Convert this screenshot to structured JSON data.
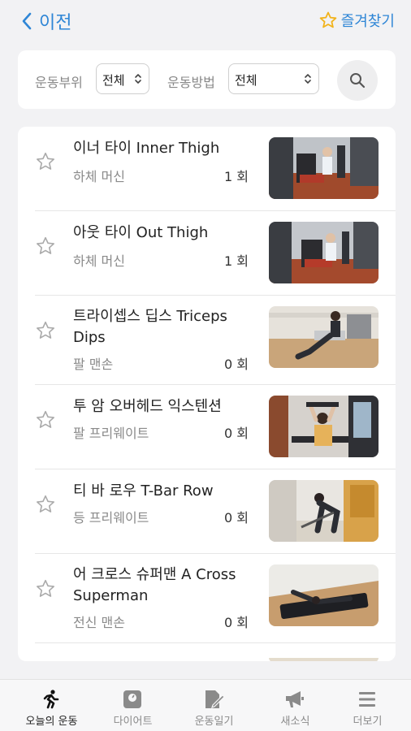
{
  "header": {
    "back_label": "이전",
    "favorites_label": "즐겨찾기",
    "accent_color": "#2f86d6",
    "favorite_star_color": "#f2b31b"
  },
  "filter": {
    "body_part_label": "운동부위",
    "body_part_value": "전체",
    "method_label": "운동방법",
    "method_value": "전체",
    "search_icon": "search-icon"
  },
  "exercises": [
    {
      "title": "이너 타이 Inner Thigh",
      "category": "하체 머신",
      "count": "1 회",
      "favorited": false,
      "thumb": "thumbnail-inner-thigh"
    },
    {
      "title": "아웃 타이 Out Thigh",
      "category": "하체 머신",
      "count": "1 회",
      "favorited": false,
      "thumb": "thumbnail-out-thigh"
    },
    {
      "title": "트라이셉스 딥스 Triceps Dips",
      "category": "팔 맨손",
      "count": "0 회",
      "favorited": false,
      "thumb": "thumbnail-triceps-dips"
    },
    {
      "title": "투 암 오버헤드 익스텐션",
      "category": "팔 프리웨이트",
      "count": "0 회",
      "favorited": false,
      "thumb": "thumbnail-overhead-extension"
    },
    {
      "title": "티 바 로우 T-Bar Row",
      "category": "등 프리웨이트",
      "count": "0 회",
      "favorited": false,
      "thumb": "thumbnail-t-bar-row"
    },
    {
      "title": "어 크로스 슈퍼맨 A Cross Superman",
      "category": "전신 맨손",
      "count": "0 회",
      "favorited": false,
      "thumb": "thumbnail-cross-superman"
    }
  ],
  "bottom_nav": [
    {
      "label": "오늘의 운동",
      "icon": "running-person-icon",
      "active": true
    },
    {
      "label": "다이어트",
      "icon": "scale-icon",
      "active": false
    },
    {
      "label": "운동일기",
      "icon": "diary-pencil-icon",
      "active": false
    },
    {
      "label": "새소식",
      "icon": "megaphone-icon",
      "active": false
    },
    {
      "label": "더보기",
      "icon": "menu-icon",
      "active": false
    }
  ]
}
